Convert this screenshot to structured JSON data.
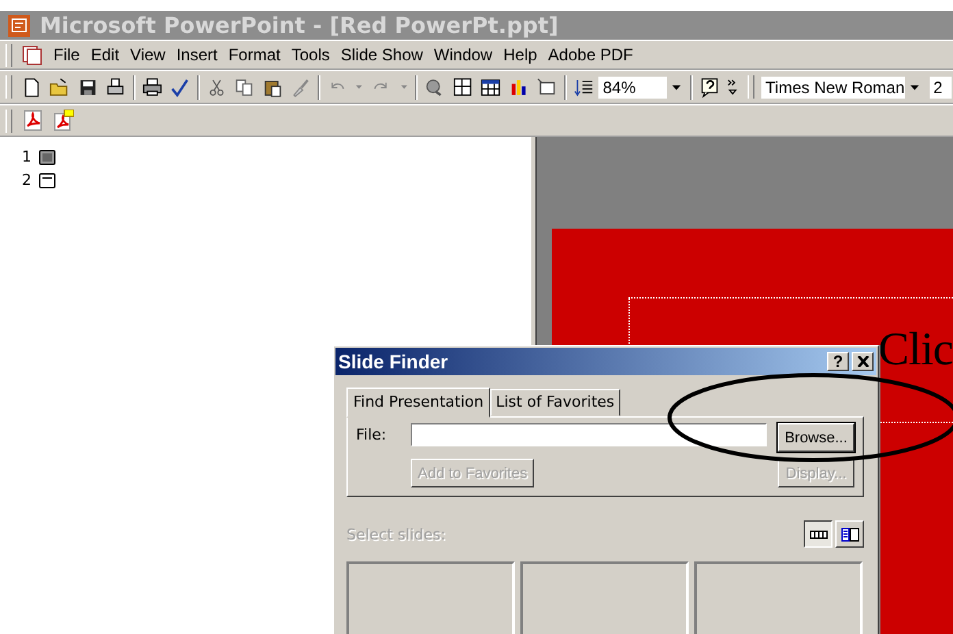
{
  "window": {
    "title": "Microsoft PowerPoint - [Red PowerPt.ppt]"
  },
  "menu": [
    "File",
    "Edit",
    "View",
    "Insert",
    "Format",
    "Tools",
    "Slide Show",
    "Window",
    "Help",
    "Adobe PDF"
  ],
  "toolbar": {
    "zoom": "84%",
    "font": "Times New Roman",
    "font_size": "2"
  },
  "outline": [
    {
      "number": "1",
      "selected": true
    },
    {
      "number": "2",
      "selected": false
    }
  ],
  "slide": {
    "title_text": "Clic"
  },
  "dialog": {
    "title": "Slide Finder",
    "help": "?",
    "tabs": [
      {
        "label": "Find Presentation",
        "selected": true
      },
      {
        "label": "List of Favorites",
        "selected": false
      }
    ],
    "file_label": "File:",
    "browse": {
      "label": "Browse...",
      "disabled": false
    },
    "add_favorites": {
      "label": "Add to Favorites",
      "disabled": true
    },
    "display": {
      "label": "Display...",
      "disabled": true
    },
    "select_label": "Select slides:",
    "views": [
      {
        "selected": true
      },
      {
        "selected": false
      }
    ]
  }
}
